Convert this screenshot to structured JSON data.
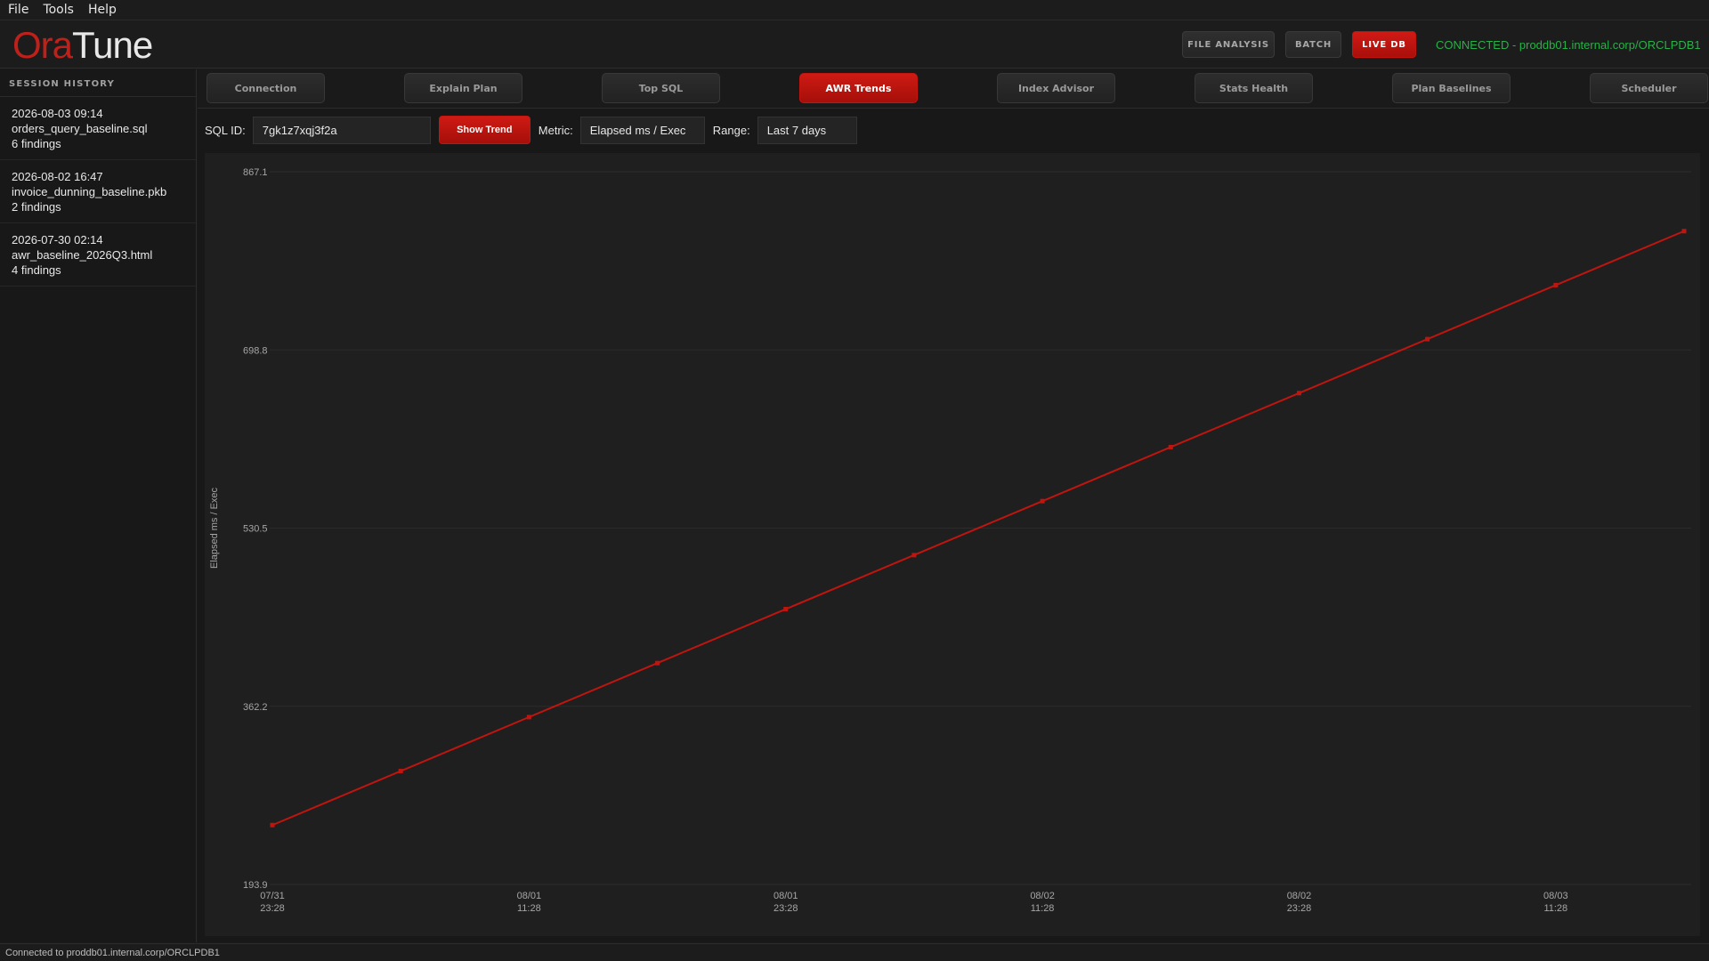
{
  "menu": {
    "items": [
      "File",
      "Tools",
      "Help"
    ]
  },
  "header": {
    "logo_part1": "Ora",
    "logo_part2": "Tune",
    "modes": [
      {
        "label": "FILE ANALYSIS",
        "active": false
      },
      {
        "label": "BATCH",
        "active": false
      },
      {
        "label": "LIVE DB",
        "active": true
      }
    ],
    "connection_status": "CONNECTED - proddb01.internal.corp/ORCLPDB1"
  },
  "sidebar": {
    "title": "SESSION HISTORY",
    "items": [
      {
        "timestamp": "2026-08-03 09:14",
        "file": "orders_query_baseline.sql",
        "findings": "6 findings"
      },
      {
        "timestamp": "2026-08-02 16:47",
        "file": "invoice_dunning_baseline.pkb",
        "findings": "2 findings"
      },
      {
        "timestamp": "2026-07-30 02:14",
        "file": "awr_baseline_2026Q3.html",
        "findings": "4 findings"
      }
    ]
  },
  "tabs": [
    {
      "label": "Connection",
      "active": false
    },
    {
      "label": "Explain Plan",
      "active": false
    },
    {
      "label": "Top SQL",
      "active": false
    },
    {
      "label": "AWR Trends",
      "active": true
    },
    {
      "label": "Index Advisor",
      "active": false
    },
    {
      "label": "Stats Health",
      "active": false
    },
    {
      "label": "Plan Baselines",
      "active": false
    },
    {
      "label": "Scheduler",
      "active": false
    }
  ],
  "toolbar": {
    "sql_id_label": "SQL ID:",
    "sql_id_value": "7gk1z7xqj3f2a",
    "show_trend_label": "Show Trend",
    "metric_label": "Metric:",
    "metric_value": "Elapsed ms / Exec",
    "range_label": "Range:",
    "range_value": "Last 7 days"
  },
  "chart_data": {
    "type": "line",
    "ylabel": "Elapsed ms / Exec",
    "ylim": [
      193.9,
      867.1
    ],
    "yticks": [
      "867.1",
      "698.8",
      "530.5",
      "362.2",
      "193.9"
    ],
    "xtick_labels": [
      [
        "07/31",
        "23:28"
      ],
      [
        "08/01",
        "11:28"
      ],
      [
        "08/01",
        "23:28"
      ],
      [
        "08/02",
        "11:28"
      ],
      [
        "08/02",
        "23:28"
      ],
      [
        "08/03",
        "11:28"
      ]
    ],
    "x": [
      "07/31 23:28",
      "08/01 05:28",
      "08/01 11:28",
      "08/01 17:28",
      "08/01 23:28",
      "08/02 05:28",
      "08/02 11:28",
      "08/02 17:28",
      "08/02 23:28",
      "08/03 05:28",
      "08/03 11:28",
      "08/03 17:28"
    ],
    "values": [
      250.0,
      301.0,
      352.0,
      403.0,
      454.0,
      505.0,
      556.0,
      607.0,
      658.0,
      709.0,
      760.0,
      811.0
    ],
    "grid": true,
    "line_color": "#c0150f"
  },
  "statusbar": {
    "text": "Connected to proddb01.internal.corp/ORCLPDB1"
  }
}
